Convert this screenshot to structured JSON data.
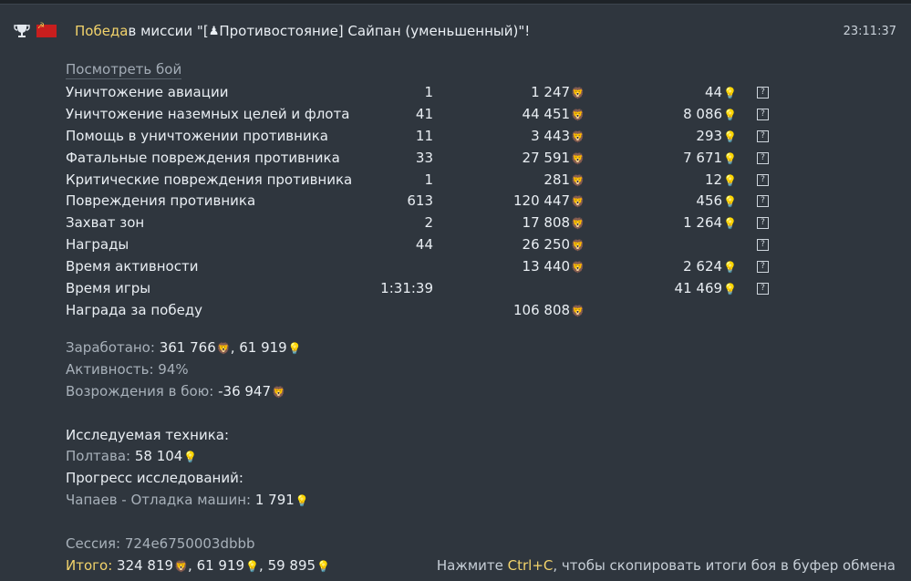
{
  "header": {
    "result": "Победа",
    "text": " в миссии \"[",
    "mode_icon": "figure-icon",
    "mission": " Противостояние] Сайпан (уменьшенный)\"!",
    "time": "23:11:37",
    "country": "USSR"
  },
  "watch_battle": "Посмотреть бой",
  "rows": [
    {
      "name": "Уничтожение авиации",
      "count": "1",
      "sl": "1 247",
      "rp": "44",
      "help": "?"
    },
    {
      "name": "Уничтожение наземных целей и флота",
      "count": "41",
      "sl": "44 451",
      "rp": "8 086",
      "help": "?"
    },
    {
      "name": "Помощь в уничтожении противника",
      "count": "11",
      "sl": "3 443",
      "rp": "293",
      "help": "?"
    },
    {
      "name": "Фатальные повреждения противника",
      "count": "33",
      "sl": "27 591",
      "rp": "7 671",
      "help": "?"
    },
    {
      "name": "Критические повреждения противника",
      "count": "1",
      "sl": "281",
      "rp": "12",
      "help": "?"
    },
    {
      "name": "Повреждения противника",
      "count": "613",
      "sl": "120 447",
      "rp": "456",
      "help": "?"
    },
    {
      "name": "Захват зон",
      "count": "2",
      "sl": "17 808",
      "rp": "1 264",
      "help": "?"
    },
    {
      "name": "Награды",
      "count": "44",
      "sl": "26 250",
      "rp": "",
      "help": "?"
    },
    {
      "name": "Время активности",
      "count": "",
      "sl": "13 440",
      "rp": "2 624",
      "help": "?"
    },
    {
      "name": "Время игры",
      "count": "1:31:39",
      "sl": "",
      "rp": "41 469",
      "help": "?"
    },
    {
      "name": "Награда за победу",
      "count": "",
      "sl": "106 808",
      "rp": "",
      "help": ""
    }
  ],
  "earned": {
    "label": "Заработано:",
    "sl": "361 766",
    "crp": "61 919"
  },
  "activity": {
    "label": "Активность:",
    "value": "94%"
  },
  "respawns": {
    "label": "Возрождения в бою:",
    "sl": "-36 947"
  },
  "research": {
    "title": "Исследуемая техника:",
    "vehicle_label": "Полтава:",
    "vehicle_rp": "58 104",
    "progress_title": "Прогресс исследований:",
    "module_label": "Чапаев - Отладка машин:",
    "module_rp": "1 791"
  },
  "session": {
    "label": "Сессия:",
    "value": "724e6750003dbbb"
  },
  "total": {
    "label": "Итого:",
    "sl": "324 819",
    "crp": "61 919",
    "rp": "59 895"
  },
  "hint": {
    "pre": "Нажмите ",
    "key": "Ctrl+C",
    "post": ", чтобы скопировать итоги боя в буфер обмена"
  },
  "colors": {
    "accent": "#f2d36b",
    "rp": "#7da6e2",
    "crp": "#f2e65a",
    "bg": "#2f363e"
  }
}
